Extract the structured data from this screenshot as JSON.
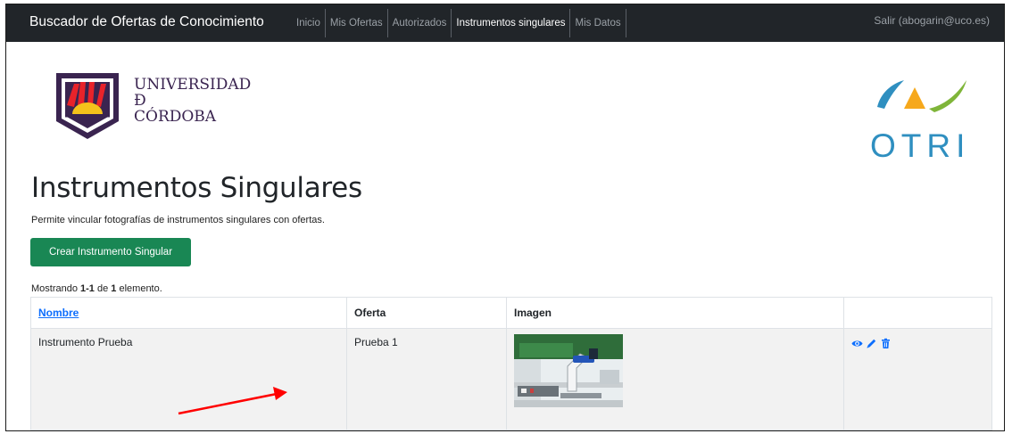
{
  "navbar": {
    "brand": "Buscador de Ofertas de Conocimiento",
    "items": [
      {
        "label": "Inicio",
        "active": false
      },
      {
        "label": "Mis Ofertas",
        "active": false
      },
      {
        "label": "Autorizados",
        "active": false
      },
      {
        "label": "Instrumentos singulares",
        "active": true
      },
      {
        "label": "Mis Datos",
        "active": false
      }
    ],
    "logout": "Salir (abogarin@uco.es)"
  },
  "logos": {
    "uco": {
      "line1": "UNIVERSIDAD",
      "line2": "Đ",
      "line3": "CÓRDOBA"
    },
    "otri": "OTRI"
  },
  "page": {
    "title": "Instrumentos Singulares",
    "description": "Permite vincular fotografías de instrumentos singulares con ofertas.",
    "create_button": "Crear Instrumento Singular",
    "summary_prefix": "Mostrando ",
    "summary_range": "1-1",
    "summary_mid": " de ",
    "summary_total": "1",
    "summary_suffix": " elemento."
  },
  "table": {
    "headers": {
      "nombre": "Nombre",
      "oferta": "Oferta",
      "imagen": "Imagen",
      "acciones": ""
    },
    "rows": [
      {
        "nombre": "Instrumento Prueba",
        "oferta": "Prueba 1",
        "imagen": "microscope-photo"
      }
    ]
  },
  "colors": {
    "navbar": "#212529",
    "accent_green": "#198754",
    "link_blue": "#0d6efd",
    "annotation_arrow": "#ff0000"
  },
  "icons": [
    "view-icon",
    "edit-icon",
    "delete-icon"
  ]
}
